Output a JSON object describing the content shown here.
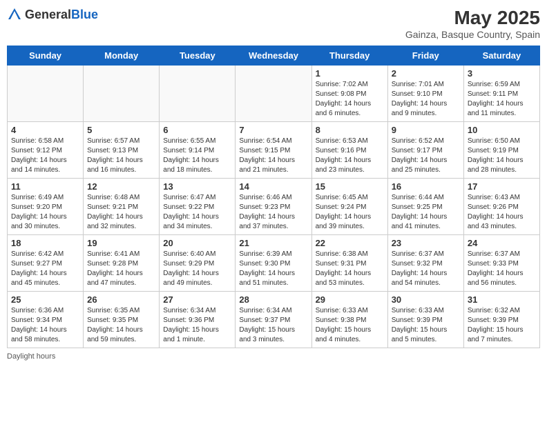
{
  "header": {
    "logo_general": "General",
    "logo_blue": "Blue",
    "title": "May 2025",
    "subtitle": "Gainza, Basque Country, Spain"
  },
  "days_of_week": [
    "Sunday",
    "Monday",
    "Tuesday",
    "Wednesday",
    "Thursday",
    "Friday",
    "Saturday"
  ],
  "weeks": [
    [
      {
        "day": "",
        "info": ""
      },
      {
        "day": "",
        "info": ""
      },
      {
        "day": "",
        "info": ""
      },
      {
        "day": "",
        "info": ""
      },
      {
        "day": "1",
        "info": "Sunrise: 7:02 AM\nSunset: 9:08 PM\nDaylight: 14 hours\nand 6 minutes."
      },
      {
        "day": "2",
        "info": "Sunrise: 7:01 AM\nSunset: 9:10 PM\nDaylight: 14 hours\nand 9 minutes."
      },
      {
        "day": "3",
        "info": "Sunrise: 6:59 AM\nSunset: 9:11 PM\nDaylight: 14 hours\nand 11 minutes."
      }
    ],
    [
      {
        "day": "4",
        "info": "Sunrise: 6:58 AM\nSunset: 9:12 PM\nDaylight: 14 hours\nand 14 minutes."
      },
      {
        "day": "5",
        "info": "Sunrise: 6:57 AM\nSunset: 9:13 PM\nDaylight: 14 hours\nand 16 minutes."
      },
      {
        "day": "6",
        "info": "Sunrise: 6:55 AM\nSunset: 9:14 PM\nDaylight: 14 hours\nand 18 minutes."
      },
      {
        "day": "7",
        "info": "Sunrise: 6:54 AM\nSunset: 9:15 PM\nDaylight: 14 hours\nand 21 minutes."
      },
      {
        "day": "8",
        "info": "Sunrise: 6:53 AM\nSunset: 9:16 PM\nDaylight: 14 hours\nand 23 minutes."
      },
      {
        "day": "9",
        "info": "Sunrise: 6:52 AM\nSunset: 9:17 PM\nDaylight: 14 hours\nand 25 minutes."
      },
      {
        "day": "10",
        "info": "Sunrise: 6:50 AM\nSunset: 9:19 PM\nDaylight: 14 hours\nand 28 minutes."
      }
    ],
    [
      {
        "day": "11",
        "info": "Sunrise: 6:49 AM\nSunset: 9:20 PM\nDaylight: 14 hours\nand 30 minutes."
      },
      {
        "day": "12",
        "info": "Sunrise: 6:48 AM\nSunset: 9:21 PM\nDaylight: 14 hours\nand 32 minutes."
      },
      {
        "day": "13",
        "info": "Sunrise: 6:47 AM\nSunset: 9:22 PM\nDaylight: 14 hours\nand 34 minutes."
      },
      {
        "day": "14",
        "info": "Sunrise: 6:46 AM\nSunset: 9:23 PM\nDaylight: 14 hours\nand 37 minutes."
      },
      {
        "day": "15",
        "info": "Sunrise: 6:45 AM\nSunset: 9:24 PM\nDaylight: 14 hours\nand 39 minutes."
      },
      {
        "day": "16",
        "info": "Sunrise: 6:44 AM\nSunset: 9:25 PM\nDaylight: 14 hours\nand 41 minutes."
      },
      {
        "day": "17",
        "info": "Sunrise: 6:43 AM\nSunset: 9:26 PM\nDaylight: 14 hours\nand 43 minutes."
      }
    ],
    [
      {
        "day": "18",
        "info": "Sunrise: 6:42 AM\nSunset: 9:27 PM\nDaylight: 14 hours\nand 45 minutes."
      },
      {
        "day": "19",
        "info": "Sunrise: 6:41 AM\nSunset: 9:28 PM\nDaylight: 14 hours\nand 47 minutes."
      },
      {
        "day": "20",
        "info": "Sunrise: 6:40 AM\nSunset: 9:29 PM\nDaylight: 14 hours\nand 49 minutes."
      },
      {
        "day": "21",
        "info": "Sunrise: 6:39 AM\nSunset: 9:30 PM\nDaylight: 14 hours\nand 51 minutes."
      },
      {
        "day": "22",
        "info": "Sunrise: 6:38 AM\nSunset: 9:31 PM\nDaylight: 14 hours\nand 53 minutes."
      },
      {
        "day": "23",
        "info": "Sunrise: 6:37 AM\nSunset: 9:32 PM\nDaylight: 14 hours\nand 54 minutes."
      },
      {
        "day": "24",
        "info": "Sunrise: 6:37 AM\nSunset: 9:33 PM\nDaylight: 14 hours\nand 56 minutes."
      }
    ],
    [
      {
        "day": "25",
        "info": "Sunrise: 6:36 AM\nSunset: 9:34 PM\nDaylight: 14 hours\nand 58 minutes."
      },
      {
        "day": "26",
        "info": "Sunrise: 6:35 AM\nSunset: 9:35 PM\nDaylight: 14 hours\nand 59 minutes."
      },
      {
        "day": "27",
        "info": "Sunrise: 6:34 AM\nSunset: 9:36 PM\nDaylight: 15 hours\nand 1 minute."
      },
      {
        "day": "28",
        "info": "Sunrise: 6:34 AM\nSunset: 9:37 PM\nDaylight: 15 hours\nand 3 minutes."
      },
      {
        "day": "29",
        "info": "Sunrise: 6:33 AM\nSunset: 9:38 PM\nDaylight: 15 hours\nand 4 minutes."
      },
      {
        "day": "30",
        "info": "Sunrise: 6:33 AM\nSunset: 9:39 PM\nDaylight: 15 hours\nand 5 minutes."
      },
      {
        "day": "31",
        "info": "Sunrise: 6:32 AM\nSunset: 9:39 PM\nDaylight: 15 hours\nand 7 minutes."
      }
    ]
  ],
  "footer": "Daylight hours"
}
